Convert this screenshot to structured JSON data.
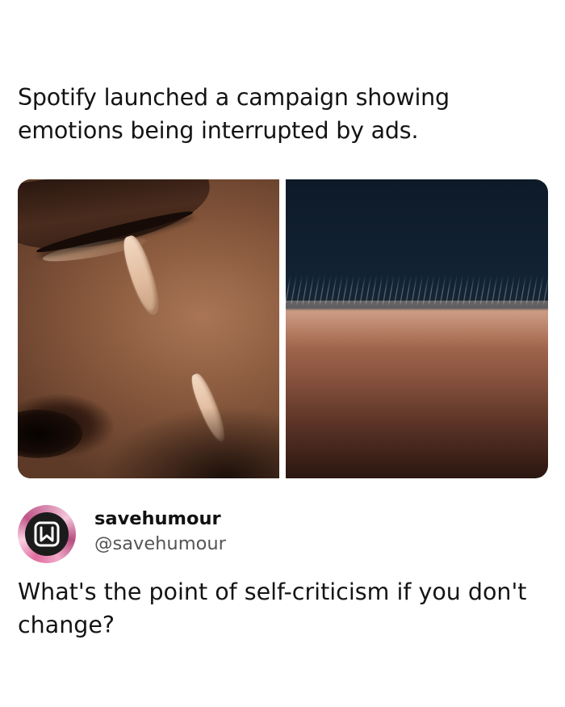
{
  "caption": "Spotify launched a campaign showing emotions being interrupted by ads.",
  "images": [
    {
      "description_icon": "crying-eye-photo-icon"
    },
    {
      "description_icon": "goosebumps-arm-photo-icon"
    }
  ],
  "profile": {
    "display_name": "savehumour",
    "handle": "@savehumour",
    "avatar_icon": "bookmark-icon"
  },
  "post_text": "What's the point of self-criticism if you don't change?",
  "colors": {
    "background": "#ffffff",
    "text": "#141414",
    "handle": "#555555",
    "avatar_ring": "#d88ab0"
  }
}
